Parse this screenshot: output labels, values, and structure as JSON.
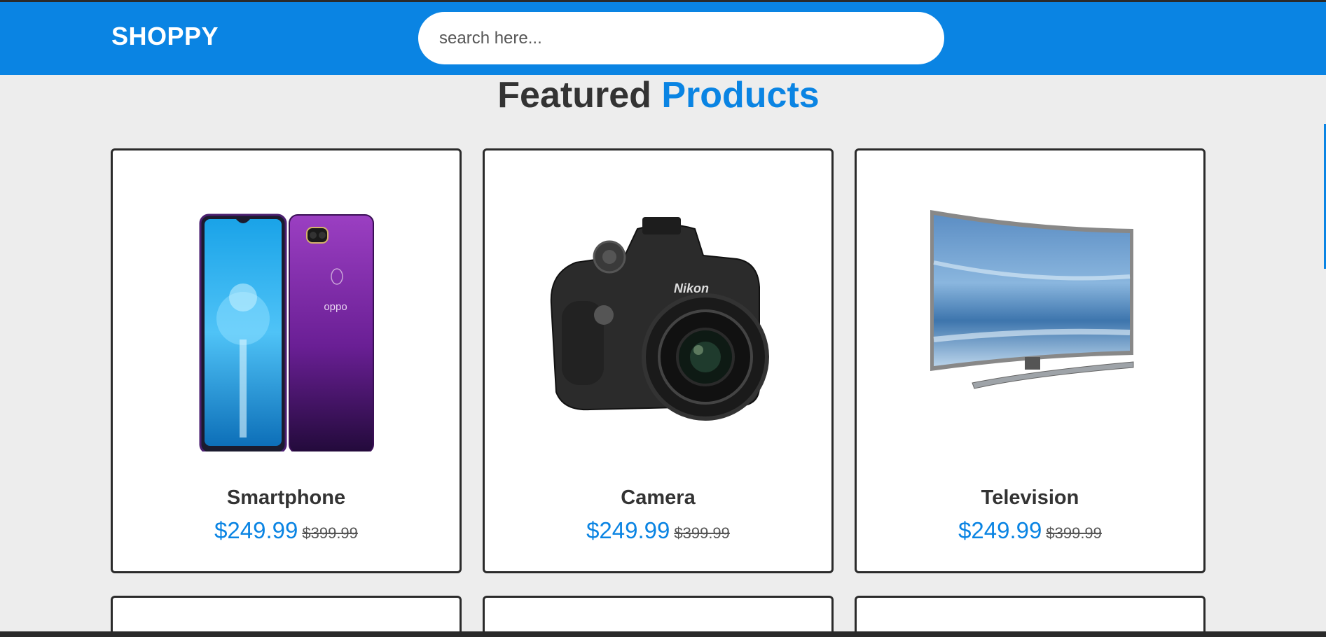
{
  "header": {
    "logo": "SHOPPY",
    "search_placeholder": "search here..."
  },
  "heading": {
    "main": "Featured",
    "accent": "Products"
  },
  "products": [
    {
      "name": "Smartphone",
      "price": "$249.99",
      "old_price": "$399.99",
      "icon": "smartphone-image"
    },
    {
      "name": "Camera",
      "price": "$249.99",
      "old_price": "$399.99",
      "icon": "camera-image"
    },
    {
      "name": "Television",
      "price": "$249.99",
      "old_price": "$399.99",
      "icon": "television-image"
    }
  ],
  "colors": {
    "accent": "#0a84e3",
    "text": "#333333",
    "background": "#ededed"
  }
}
